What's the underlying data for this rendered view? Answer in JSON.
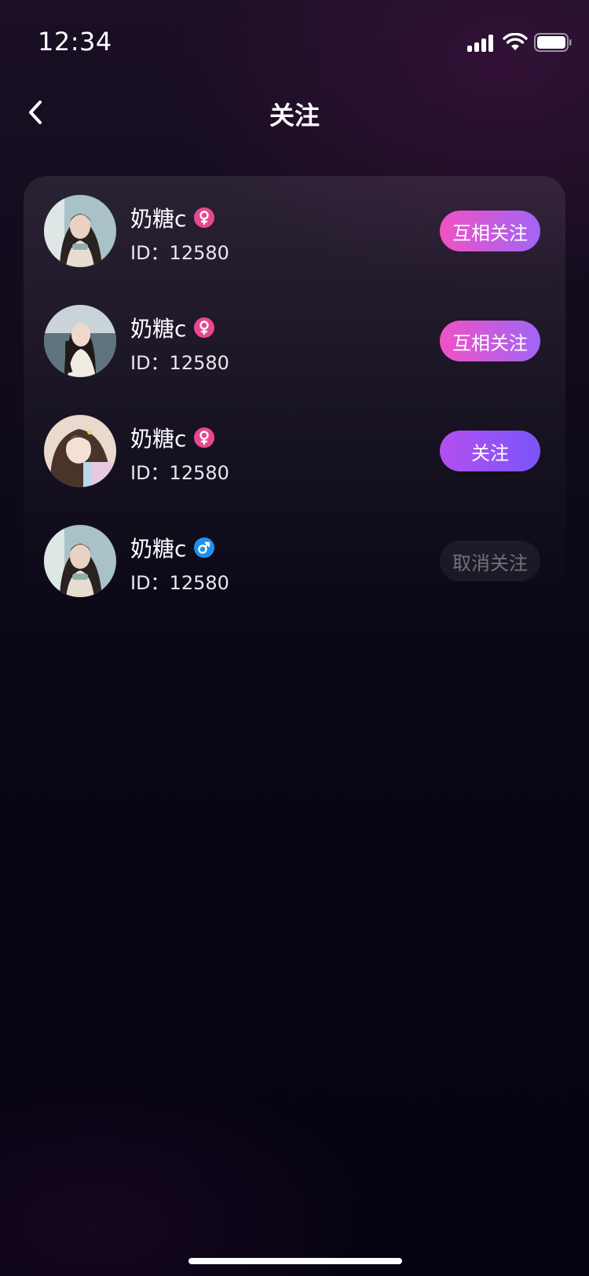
{
  "status_bar": {
    "time": "12:34"
  },
  "header": {
    "title": "关注"
  },
  "follow_list": [
    {
      "name": "奶糖c",
      "id_text": "ID：12580",
      "gender": "female",
      "action_label": "互相关注",
      "action_style": "mutual"
    },
    {
      "name": "奶糖c",
      "id_text": "ID：12580",
      "gender": "female",
      "action_label": "互相关注",
      "action_style": "mutual"
    },
    {
      "name": "奶糖c",
      "id_text": "ID：12580",
      "gender": "female",
      "action_label": "关注",
      "action_style": "follow"
    },
    {
      "name": "奶糖c",
      "id_text": "ID：12580",
      "gender": "male",
      "action_label": "取消关注",
      "action_style": "cancel"
    }
  ],
  "colors": {
    "female_badge": "#e8488e",
    "male_badge": "#1e90f0",
    "mutual_gradient": [
      "#f052c4",
      "#a065f5"
    ],
    "follow_gradient": [
      "#b34ff0",
      "#7a55fa"
    ]
  },
  "icons": {
    "back": "chevron-left-icon",
    "female": "female-symbol-icon",
    "male": "male-symbol-icon"
  }
}
